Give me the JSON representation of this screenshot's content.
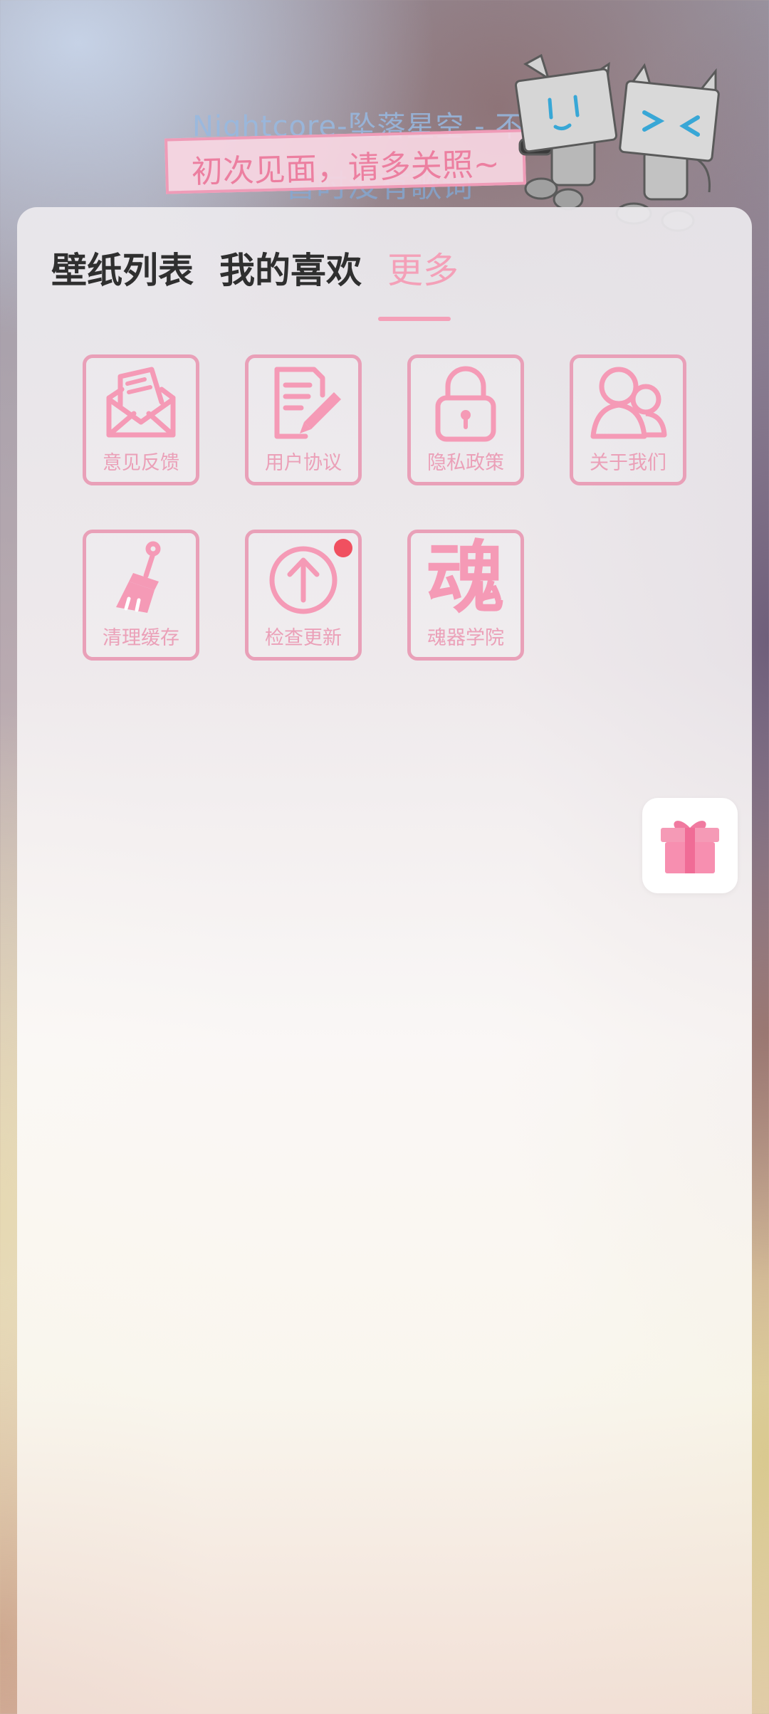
{
  "header": {
    "song_title": "Nightcore-坠落星空 - 不知",
    "lyrics": "暂时没有歌词",
    "greeting": "初次见面，请多关照~"
  },
  "tabs": [
    {
      "label": "壁纸列表",
      "active": false
    },
    {
      "label": "我的喜欢",
      "active": false
    },
    {
      "label": "更多",
      "active": true
    }
  ],
  "grid": {
    "items": [
      {
        "label": "意见反馈",
        "icon": "envelope-icon"
      },
      {
        "label": "用户协议",
        "icon": "document-pen-icon"
      },
      {
        "label": "隐私政策",
        "icon": "lock-icon"
      },
      {
        "label": "关于我们",
        "icon": "people-icon"
      },
      {
        "label": "清理缓存",
        "icon": "brush-icon"
      },
      {
        "label": "检查更新",
        "icon": "upload-arrow-icon",
        "badge": true
      },
      {
        "label": "魂器学院",
        "icon": "soul-character",
        "glyph": "魂"
      }
    ]
  },
  "floating": {
    "gift_icon": "gift-icon"
  },
  "colors": {
    "accent_pink": "#f4a0b8",
    "tile_border": "#e9a0b8",
    "badge_red": "#f05060",
    "tab_dark": "#2f2f2f"
  }
}
